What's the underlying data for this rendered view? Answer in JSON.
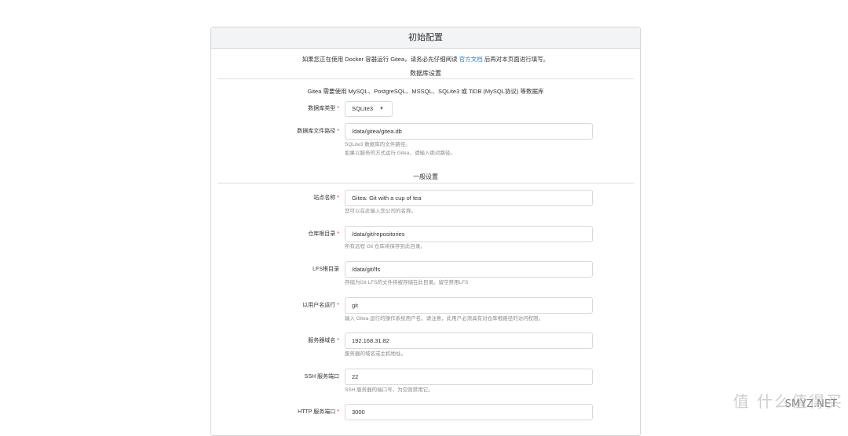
{
  "panel": {
    "title": "初始配置",
    "notice_before": "如果您正在使用 Docker 容器运行 Gitea，请务必先仔细阅读 ",
    "notice_link": "官方文档",
    "notice_after": " 后再对本页面进行填写。"
  },
  "database": {
    "section_title": "数据库设置",
    "help": "Gitea 需要使用 MySQL、PostgreSQL、MSSQL、SQLite3 或 TiDB (MySQL协议) 等数据库",
    "type_label": "数据库类型",
    "type_value": "SQLite3",
    "path_label": "数据库文件路径",
    "path_value": "/data/gitea/gitea.db",
    "path_help_1": "SQLite3 数据库的文件路径。",
    "path_help_2": "如果以服务的方式运行 Gitea，请输入绝对路径。"
  },
  "general": {
    "section_title": "一般设置",
    "site_name_label": "站点名称",
    "site_name_value": "Gitea: Git with a cup of tea",
    "site_name_help": "您可以在此输入您公司的名称。",
    "repo_root_label": "仓库根目录",
    "repo_root_value": "/data/git/repositories",
    "repo_root_help": "所有远程 Git 仓库将保存到此目录。",
    "lfs_label": "LFS根目录",
    "lfs_value": "/data/git/lfs",
    "lfs_help": "存储为Git LFS的文件将被存储在此目录。留空禁用LFS",
    "run_user_label": "以用户名运行",
    "run_user_value": "git",
    "run_user_help": "输入 Gitea 运行的操作系统用户名。请注意，此用户必须具有对仓库根路径的访问权限。",
    "domain_label": "服务器域名",
    "domain_value": "192.168.31.82",
    "domain_help": "服务器的域名或主机地址。",
    "ssh_port_label": "SSH 服务端口",
    "ssh_port_value": "22",
    "ssh_port_help": "SSH 服务器的端口号，为空则禁用它。",
    "http_port_label": "HTTP 服务端口",
    "http_port_value": "3000"
  },
  "required_mark": "*",
  "dropdown_caret": "▼",
  "watermark": "值 什么值得买",
  "watermark_sub": "SMYZ.NET"
}
